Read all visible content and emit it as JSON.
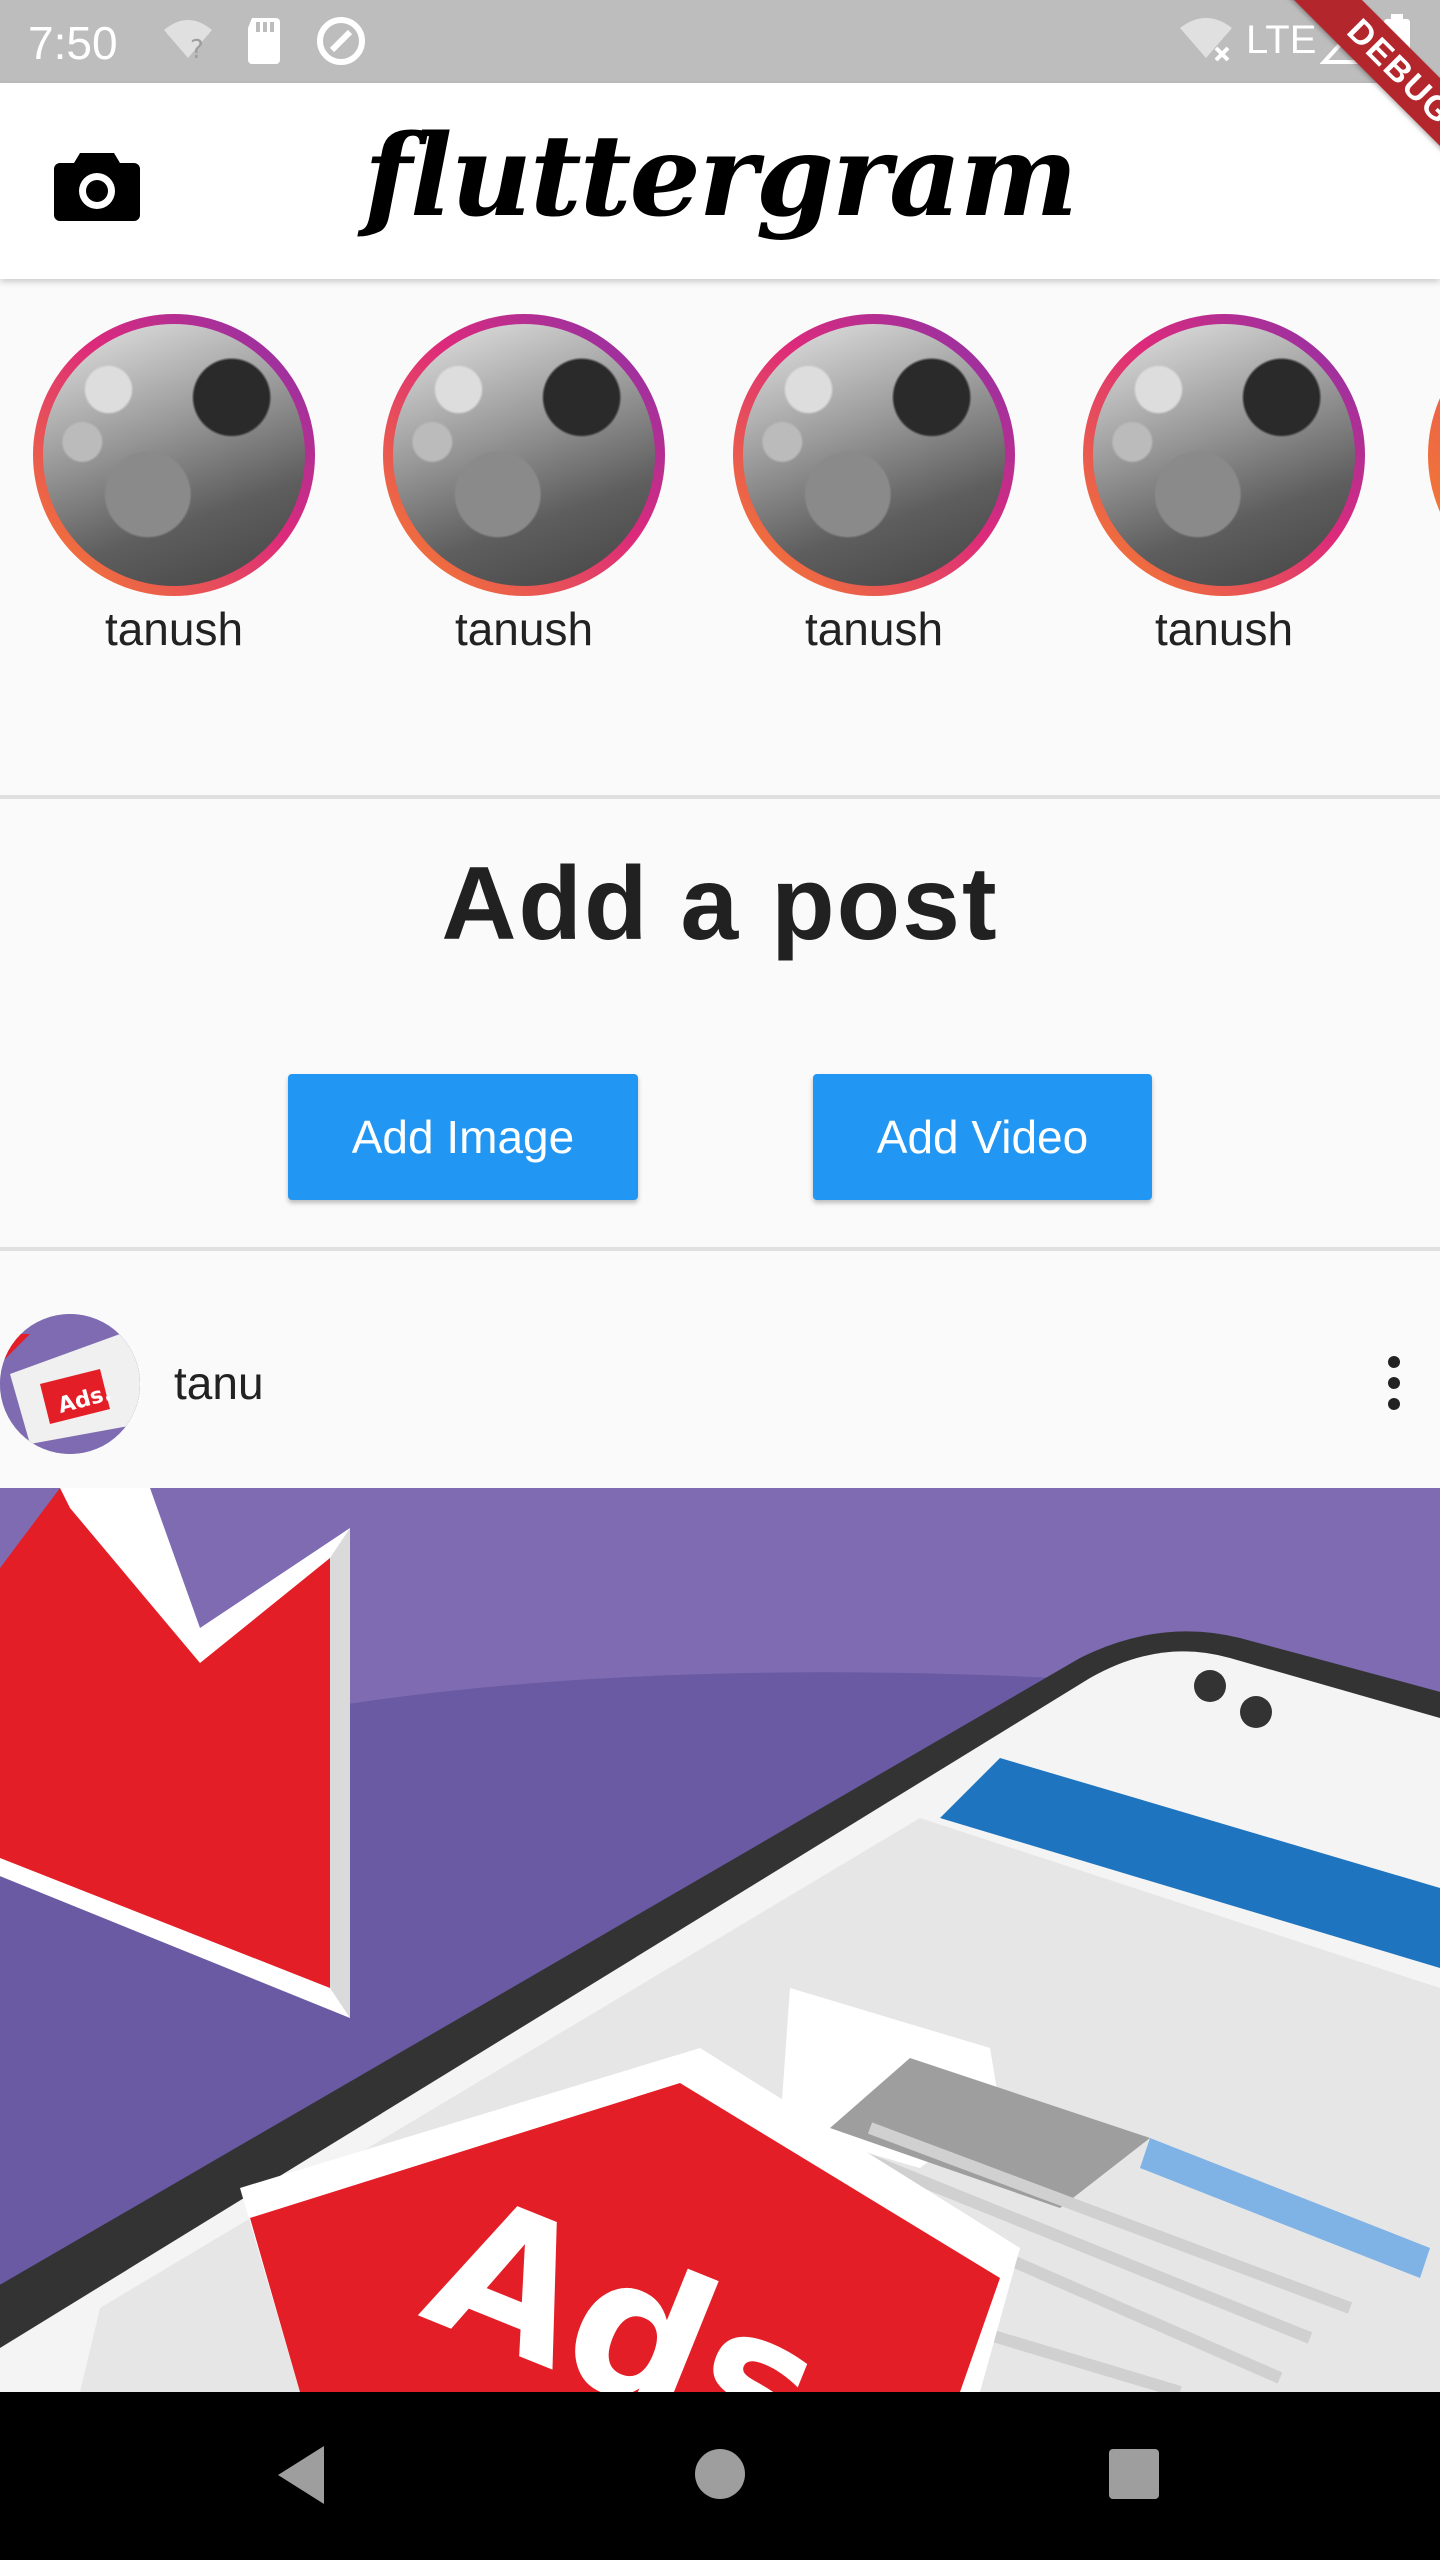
{
  "status_bar": {
    "time": "7:50",
    "network": "LTE",
    "icons": [
      "wifi-unknown-icon",
      "sd-card-icon",
      "sync-icon",
      "wifi-off-icon",
      "signal-icon",
      "battery-icon"
    ]
  },
  "debug_banner": "DEBUG",
  "app_bar": {
    "title": "fluttergram",
    "left_icon": "camera-icon"
  },
  "stories": [
    {
      "name": "tanush"
    },
    {
      "name": "tanush"
    },
    {
      "name": "tanush"
    },
    {
      "name": "tanush"
    }
  ],
  "add_post": {
    "title": "Add a post",
    "add_image_label": "Add Image",
    "add_video_label": "Add Video"
  },
  "post": {
    "username": "tanu",
    "more_icon": "more-vert-icon",
    "image_text": "Ads"
  },
  "colors": {
    "primary": "#2196f3",
    "status_bar": "#bdbdbd",
    "debug_ribbon": "#b3262c",
    "post_bg_purple": "#7e6bb2",
    "ads_red": "#e41e26"
  },
  "nav_icons": [
    "back-icon",
    "home-icon",
    "recents-icon"
  ]
}
